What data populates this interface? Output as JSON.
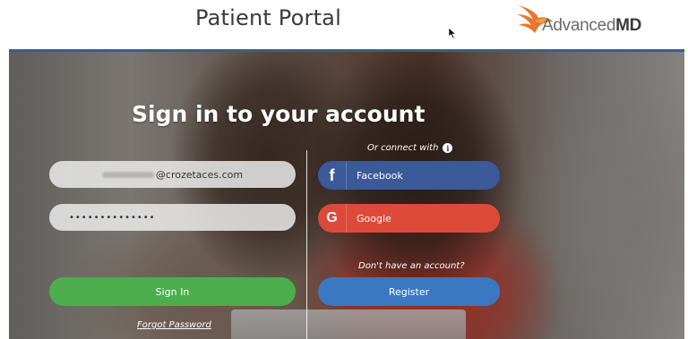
{
  "header": {
    "title": "Patient Portal",
    "logo": {
      "text_light": "Advanced",
      "text_bold": "MD",
      "color": "#e8762c"
    }
  },
  "login": {
    "heading": "Sign in to your account",
    "email_value": "@crozetaces.com",
    "password_mask": "••••••••••••••",
    "sign_in_label": "Sign In",
    "forgot_password_label": "Forgot Password"
  },
  "social": {
    "connect_with_label": "Or connect with",
    "facebook": {
      "icon": "f",
      "label": "Facebook",
      "color": "#3c5a99"
    },
    "google": {
      "icon": "G",
      "label": "Google",
      "color": "#dd4a3a"
    }
  },
  "register": {
    "prompt": "Don't have an account?",
    "label": "Register"
  },
  "colors": {
    "header_bar": "#3e5a8c",
    "sign_in_button": "#4cae4c",
    "register_button": "#3b78c2"
  }
}
